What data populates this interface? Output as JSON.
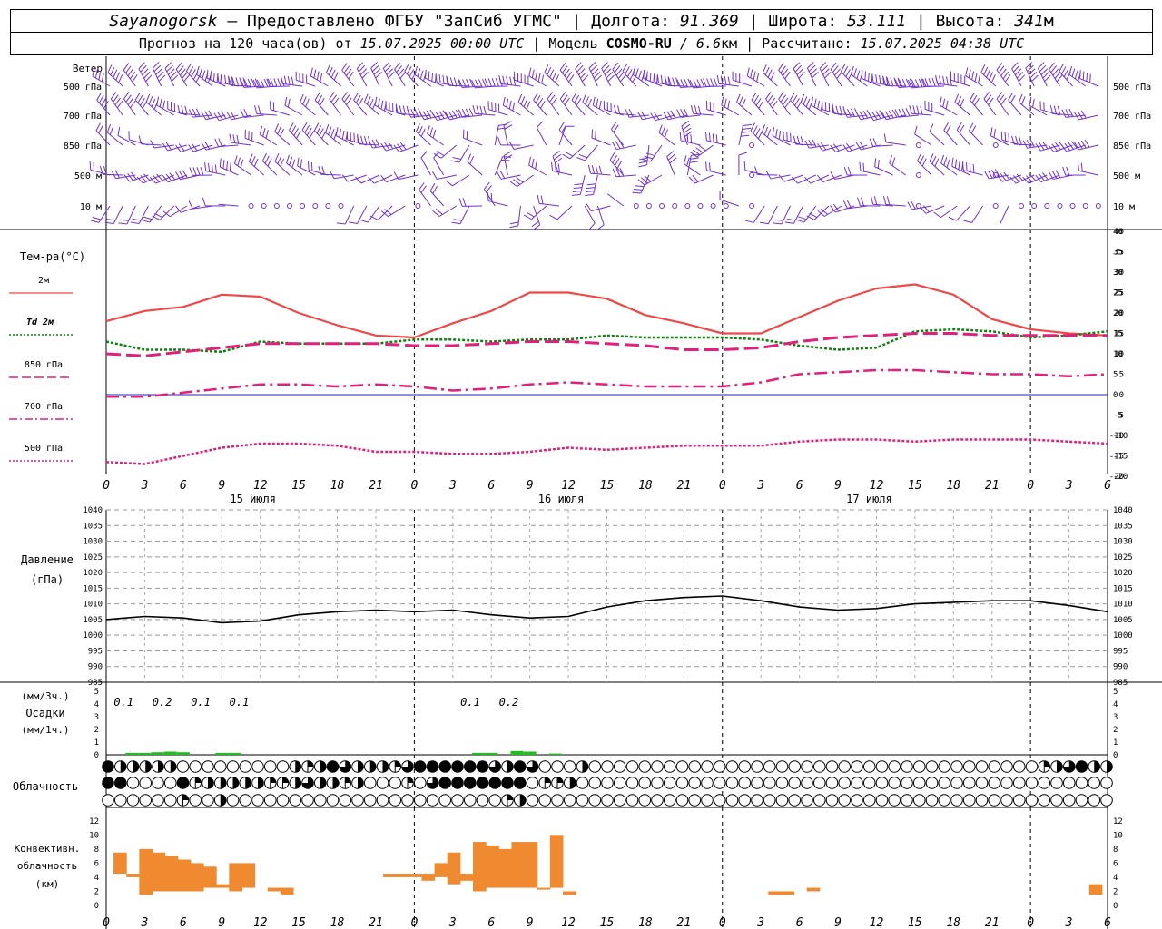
{
  "header": {
    "station": "Sayanogorsk",
    "provided_by": " — Предоставлено ФГБУ \"ЗапСиб УГМС\" | Долгота: ",
    "lon": "91.369",
    "sep_lat": " | Широта: ",
    "lat": "53.111",
    "sep_alt": " | Высота: ",
    "alt": "341",
    "alt_unit": "м",
    "forecast_prefix": "Прогноз на 120 часа(ов) от ",
    "forecast_start": "15.07.2025 00:00 UTC",
    "model_prefix": " | Модель ",
    "model": "COSMO-RU",
    "model_res": " / 6.6",
    "model_res_unit": "км",
    "calc_prefix": " | Рассчитано: ",
    "calc_time": "15.07.2025 04:38 UTC"
  },
  "labels": {
    "wind": "Ветер",
    "wind_levels": [
      "500 гПа",
      "700 гПа",
      "850 гПа",
      "500 м",
      "10 м"
    ],
    "temp": "Тем-ра(°С)",
    "temp_legend": [
      "2м",
      "Td 2м",
      "850 гПа",
      "700 гПа",
      "500 гПа"
    ],
    "pressure_1": "Давление",
    "pressure_2": "(гПа)",
    "precip_1": "(мм/3ч.)",
    "precip_2": "Осадки",
    "precip_3": "(мм/1ч.)",
    "cloud": "Облачность",
    "conv_1": "Конвективн.",
    "conv_2": "облачность",
    "conv_3": "(км)"
  },
  "colors": {
    "wind": "#7030d0",
    "t2m": "#f04848",
    "td2m": "#108010",
    "t850": "#e0207a",
    "t700": "#e0207a",
    "t500": "#e0207a",
    "zero_line": "#2020c0",
    "pressure": "#000000",
    "precip": "#22bb22",
    "conv": "#f08a30"
  },
  "chart_data": {
    "type": "line",
    "x_ticks": [
      "0",
      "3",
      "6",
      "9",
      "12",
      "15",
      "18",
      "21",
      "0",
      "3",
      "6",
      "9",
      "12",
      "15",
      "18",
      "21",
      "0",
      "3",
      "6",
      "9",
      "12",
      "15",
      "18",
      "21",
      "0",
      "3",
      "6"
    ],
    "day_labels": [
      "15 июля",
      "16 июля",
      "17 июля"
    ],
    "temperature": {
      "ylim": [
        -20,
        40
      ],
      "y_ticks": [
        40,
        35,
        30,
        25,
        20,
        15,
        10,
        5,
        0,
        -5,
        -10,
        -15,
        -20
      ],
      "hours": [
        0,
        3,
        6,
        9,
        12,
        15,
        18,
        21,
        24,
        27,
        30,
        33,
        36,
        39,
        42,
        45,
        48,
        51,
        54,
        57,
        60,
        63,
        66,
        69,
        72,
        75,
        78
      ],
      "series": [
        {
          "name": "2м",
          "values": [
            18,
            20.5,
            21.5,
            24.5,
            24,
            20,
            17,
            14.5,
            14,
            17.5,
            20.5,
            25,
            25,
            23.5,
            19.5,
            17.5,
            15,
            15,
            19,
            23,
            26,
            27,
            24.5,
            18.5,
            16,
            15,
            14.5
          ]
        },
        {
          "name": "Td 2м",
          "values": [
            13,
            11,
            11,
            10.5,
            13,
            12.5,
            12.5,
            12.5,
            13.5,
            13.5,
            13,
            13.5,
            13.5,
            14.5,
            14,
            14,
            14,
            13.5,
            12,
            11,
            11.5,
            15.5,
            16,
            15.5,
            14,
            14.5,
            15.5
          ]
        },
        {
          "name": "850 гПа",
          "values": [
            10,
            9.5,
            10.5,
            11.5,
            12.5,
            12.5,
            12.5,
            12.5,
            12,
            12,
            12.5,
            13,
            13,
            12.5,
            12,
            11,
            11,
            11.5,
            13,
            14,
            14.5,
            15,
            15,
            14.5,
            14.5,
            14.5,
            14.5
          ]
        },
        {
          "name": "700 гПа",
          "values": [
            -0.5,
            -0.5,
            0.5,
            1.5,
            2.5,
            2.5,
            2,
            2.5,
            2,
            1,
            1.5,
            2.5,
            3,
            2.5,
            2,
            2,
            2,
            3,
            5,
            5.5,
            6,
            6,
            5.5,
            5,
            5,
            4.5,
            5
          ]
        },
        {
          "name": "500 гПа",
          "values": [
            -16.5,
            -17,
            -15,
            -13,
            -12,
            -12,
            -12.5,
            -14,
            -14,
            -14.5,
            -14.5,
            -14,
            -13,
            -13.5,
            -13,
            -12.5,
            -12.5,
            -12.5,
            -11.5,
            -11,
            -11,
            -11.5,
            -11,
            -11,
            -11,
            -11.5,
            -12
          ]
        }
      ]
    },
    "pressure": {
      "ylim": [
        985,
        1040
      ],
      "y_ticks": [
        1040,
        1035,
        1030,
        1025,
        1020,
        1015,
        1010,
        1005,
        1000,
        995,
        990,
        985
      ],
      "hours": [
        0,
        3,
        6,
        9,
        12,
        15,
        18,
        21,
        24,
        27,
        30,
        33,
        36,
        39,
        42,
        45,
        48,
        51,
        54,
        57,
        60,
        63,
        66,
        69,
        72,
        75,
        78
      ],
      "values": [
        1005,
        1006,
        1005.5,
        1004,
        1004.5,
        1006.5,
        1007.5,
        1008,
        1007.5,
        1008,
        1006.5,
        1005.5,
        1006,
        1009,
        1011,
        1012,
        1012.5,
        1011,
        1009,
        1008,
        1008.5,
        1010,
        1010.5,
        1011,
        1011,
        1009.5,
        1007.5
      ]
    },
    "precipitation": {
      "ylim": [
        0,
        5
      ],
      "y_ticks": [
        5,
        4,
        3,
        2,
        1,
        0
      ],
      "labels_3h": [
        {
          "hour": 1.5,
          "text": "0.1"
        },
        {
          "hour": 4.5,
          "text": "0.2"
        },
        {
          "hour": 7.5,
          "text": "0.1"
        },
        {
          "hour": 10.5,
          "text": "0.1"
        },
        {
          "hour": 28.5,
          "text": "0.1"
        },
        {
          "hour": 31.5,
          "text": "0.2"
        }
      ],
      "hourly_hours": [
        2,
        3,
        4,
        5,
        6,
        9,
        10,
        29,
        30,
        32,
        33,
        35
      ],
      "hourly_values": [
        0.15,
        0.15,
        0.2,
        0.25,
        0.2,
        0.15,
        0.15,
        0.15,
        0.15,
        0.3,
        0.25,
        0.1
      ]
    },
    "cloudiness": {
      "rows": [
        "high",
        "middle",
        "low"
      ],
      "row_high": [
        8,
        4,
        4,
        4,
        4,
        4,
        0,
        0,
        0,
        0,
        0,
        0,
        0,
        0,
        0,
        4,
        2,
        4,
        8,
        6,
        4,
        4,
        4,
        2,
        6,
        8,
        8,
        8,
        8,
        8,
        8,
        6,
        4,
        8,
        6,
        0,
        0,
        0,
        4,
        0,
        0,
        0,
        0,
        0,
        0,
        0,
        0,
        0,
        0,
        0,
        0,
        0,
        0,
        0,
        0,
        0,
        0,
        0,
        0,
        0,
        0,
        0,
        0,
        0,
        0,
        0,
        0,
        0,
        0,
        0,
        0,
        0,
        0,
        0,
        0,
        2,
        4,
        6,
        8,
        4,
        4
      ],
      "row_mid": [
        8,
        8,
        0,
        0,
        0,
        0,
        8,
        2,
        4,
        4,
        4,
        4,
        4,
        2,
        2,
        4,
        6,
        4,
        4,
        2,
        4,
        0,
        0,
        0,
        2,
        0,
        6,
        8,
        8,
        8,
        8,
        8,
        8,
        8,
        0,
        2,
        2,
        4,
        0,
        0,
        0,
        0,
        0,
        0,
        0,
        0,
        0,
        0,
        0,
        0,
        0,
        0,
        0,
        0,
        0,
        0,
        0,
        0,
        0,
        0,
        0,
        0,
        0,
        0,
        0,
        0,
        0,
        0,
        0,
        0,
        0,
        0,
        0,
        0,
        0,
        0,
        0,
        0,
        0,
        0,
        0
      ],
      "row_low": [
        0,
        0,
        0,
        0,
        0,
        0,
        2,
        0,
        0,
        4,
        0,
        0,
        0,
        0,
        0,
        0,
        0,
        0,
        0,
        0,
        0,
        0,
        0,
        0,
        0,
        0,
        0,
        0,
        0,
        0,
        0,
        0,
        2,
        4,
        0,
        0,
        0,
        0,
        0,
        0,
        0,
        0,
        0,
        0,
        0,
        0,
        0,
        0,
        0,
        0,
        0,
        0,
        0,
        0,
        0,
        0,
        0,
        0,
        0,
        0,
        0,
        0,
        0,
        0,
        0,
        0,
        0,
        0,
        0,
        0,
        0,
        0,
        0,
        0,
        0,
        0,
        0,
        0,
        0,
        0,
        0
      ]
    },
    "convective": {
      "ylim": [
        0,
        13
      ],
      "y_ticks": [
        12,
        10,
        8,
        6,
        4,
        2,
        0
      ],
      "cells": [
        {
          "hour": 1,
          "base": 4.5,
          "top": 7.5
        },
        {
          "hour": 2,
          "base": 4,
          "top": 4.5
        },
        {
          "hour": 3,
          "base": 1.5,
          "top": 8
        },
        {
          "hour": 4,
          "base": 2,
          "top": 7.5
        },
        {
          "hour": 5,
          "base": 2,
          "top": 7
        },
        {
          "hour": 6,
          "base": 2,
          "top": 6.5
        },
        {
          "hour": 7,
          "base": 2,
          "top": 6
        },
        {
          "hour": 8,
          "base": 2.5,
          "top": 5.5
        },
        {
          "hour": 9,
          "base": 2.5,
          "top": 3
        },
        {
          "hour": 10,
          "base": 2,
          "top": 6
        },
        {
          "hour": 11,
          "base": 2.5,
          "top": 6
        },
        {
          "hour": 13,
          "base": 2,
          "top": 2.5
        },
        {
          "hour": 14,
          "base": 1.5,
          "top": 2.5
        },
        {
          "hour": 22,
          "base": 4,
          "top": 4.5
        },
        {
          "hour": 23,
          "base": 4,
          "top": 4.5
        },
        {
          "hour": 24,
          "base": 4,
          "top": 4.5
        },
        {
          "hour": 25,
          "base": 3.5,
          "top": 4.5
        },
        {
          "hour": 26,
          "base": 4,
          "top": 6
        },
        {
          "hour": 27,
          "base": 3,
          "top": 7.5
        },
        {
          "hour": 28,
          "base": 3.5,
          "top": 4.5
        },
        {
          "hour": 29,
          "base": 2,
          "top": 9
        },
        {
          "hour": 30,
          "base": 2.5,
          "top": 8.5
        },
        {
          "hour": 31,
          "base": 2.5,
          "top": 8
        },
        {
          "hour": 32,
          "base": 2.5,
          "top": 9
        },
        {
          "hour": 33,
          "base": 2.5,
          "top": 9
        },
        {
          "hour": 34,
          "base": 2.5,
          "top": 2.5
        },
        {
          "hour": 35,
          "base": 2.5,
          "top": 10
        },
        {
          "hour": 36,
          "base": 1.5,
          "top": 2
        },
        {
          "hour": 52,
          "base": 1.5,
          "top": 2
        },
        {
          "hour": 53,
          "base": 1.5,
          "top": 2
        },
        {
          "hour": 55,
          "base": 2,
          "top": 2.5
        },
        {
          "hour": 77,
          "base": 1.5,
          "top": 3
        }
      ]
    }
  }
}
